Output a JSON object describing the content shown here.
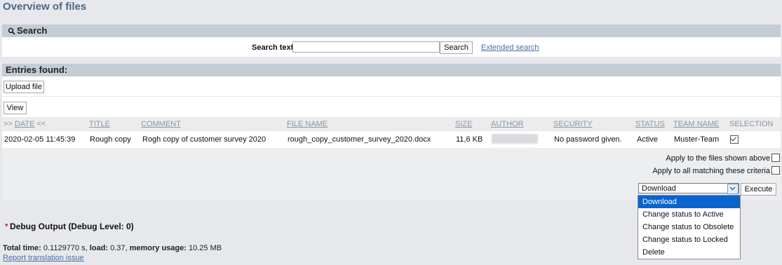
{
  "page": {
    "title": "Overview of files"
  },
  "search": {
    "header": "Search",
    "label": "Search text",
    "input_value": "",
    "button": "Search",
    "extended_link": "Extended search"
  },
  "entries": {
    "header": "Entries found:",
    "upload_button": "Upload file",
    "view_button": "View",
    "sort_prefix": ">>",
    "sort_suffix": "<<",
    "columns": [
      "DATE",
      "TITLE",
      "COMMENT",
      "FILE NAME",
      "SIZE",
      "AUTHOR",
      "SECURITY",
      "STATUS",
      "TEAM NAME",
      "SELECTION"
    ],
    "rows": [
      {
        "date": "2020-02-05 11:45:39",
        "title": "Rough copy",
        "comment": "Rogh copy of customer survey 2020",
        "file_name": "rough_copy_customer_survey_2020.docx",
        "size": "11,6 KB",
        "author": "",
        "security": "No password given.",
        "status": "Active",
        "team_name": "Muster-Team",
        "selected": true
      }
    ]
  },
  "actions": {
    "apply_shown": "Apply to the files shown above",
    "apply_matching": "Apply to all matching these criteria",
    "apply_shown_checked": false,
    "apply_matching_checked": false,
    "selected_action": "Download",
    "execute_button": "Execute",
    "options": [
      "Download",
      "Change status to Active",
      "Change status to Obsolete",
      "Change status to Locked",
      "Delete"
    ]
  },
  "debug": {
    "title": "Debug Output (Debug Level: 0)",
    "total_time_label": "Total time:",
    "total_time_value": "0.1129770 s,",
    "load_label": "load:",
    "load_value": "0.37,",
    "memory_label": "memory usage:",
    "memory_value": "10.25 MB",
    "translation_link": "Report translation issue"
  },
  "colors": {
    "accent_title": "#4a6a86",
    "section_header_bg": "#c4ccd4",
    "link": "#4a6ea9",
    "dropdown_selected": "#0a64d0"
  }
}
